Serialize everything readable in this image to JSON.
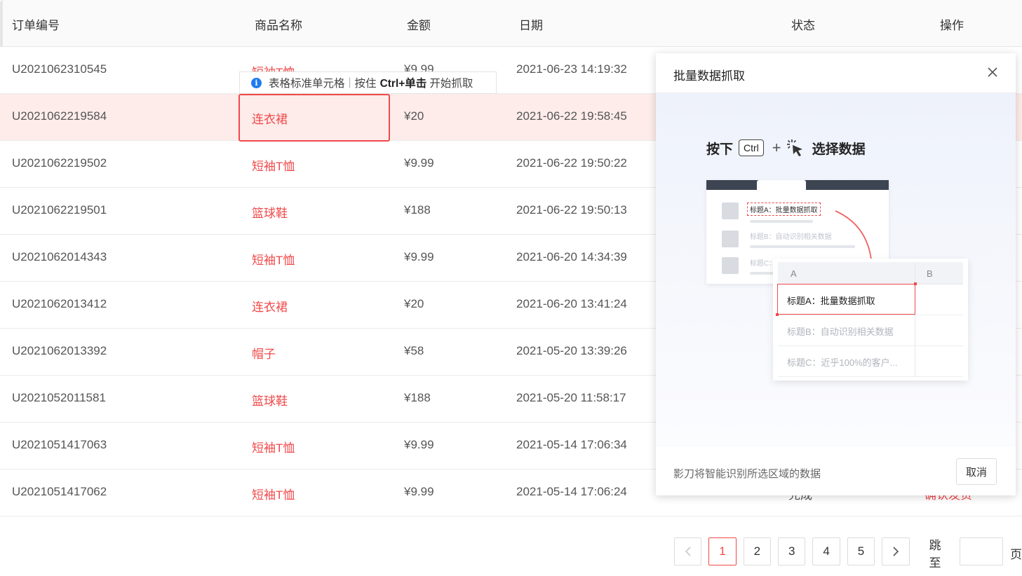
{
  "table": {
    "headers": {
      "order_id": "订单编号",
      "product": "商品名称",
      "amount": "金额",
      "date": "日期",
      "status": "状态",
      "action": "操作"
    },
    "rows": [
      {
        "order_id": "U2021062310545",
        "product": "短袖T恤",
        "amount": "¥9.99",
        "date": "2021-06-23 14:19:32",
        "status": "",
        "action": ""
      },
      {
        "order_id": "U2021062219584",
        "product": "连衣裙",
        "amount": "¥20",
        "date": "2021-06-22 19:58:45",
        "status": "",
        "action": ""
      },
      {
        "order_id": "U2021062219502",
        "product": "短袖T恤",
        "amount": "¥9.99",
        "date": "2021-06-22 19:50:22",
        "status": "",
        "action": ""
      },
      {
        "order_id": "U2021062219501",
        "product": "篮球鞋",
        "amount": "¥188",
        "date": "2021-06-22 19:50:13",
        "status": "",
        "action": ""
      },
      {
        "order_id": "U2021062014343",
        "product": "短袖T恤",
        "amount": "¥9.99",
        "date": "2021-06-20 14:34:39",
        "status": "",
        "action": ""
      },
      {
        "order_id": "U2021062013412",
        "product": "连衣裙",
        "amount": "¥20",
        "date": "2021-06-20 13:41:24",
        "status": "",
        "action": ""
      },
      {
        "order_id": "U2021062013392",
        "product": "帽子",
        "amount": "¥58",
        "date": "2021-05-20 13:39:26",
        "status": "",
        "action": ""
      },
      {
        "order_id": "U2021052011581",
        "product": "篮球鞋",
        "amount": "¥188",
        "date": "2021-05-20 11:58:17",
        "status": "",
        "action": ""
      },
      {
        "order_id": "U2021051417063",
        "product": "短袖T恤",
        "amount": "¥9.99",
        "date": "2021-05-14 17:06:34",
        "status": "",
        "action": ""
      },
      {
        "order_id": "U2021051417062",
        "product": "短袖T恤",
        "amount": "¥9.99",
        "date": "2021-05-14 17:06:24",
        "status": "完成",
        "action": "确认发货"
      }
    ]
  },
  "tooltip": {
    "icon": "info-icon",
    "type_text": "表格标准单元格",
    "hint_prefix": "按住",
    "hint_keys": "Ctrl+单击",
    "hint_suffix": "开始抓取"
  },
  "pagination": {
    "pages": [
      "1",
      "2",
      "3",
      "4",
      "5"
    ],
    "current": "1",
    "jump_label": "跳至",
    "jump_value": "",
    "page_unit": "页"
  },
  "modal": {
    "title": "批量数据抓取",
    "close_icon": "close-icon",
    "hint": "影刀将智能识别所选区域的数据",
    "cancel_label": "取消",
    "illustration": {
      "press": "按下",
      "key": "Ctrl",
      "plus": "+",
      "select": "选择数据",
      "browser_items": [
        "标题A：批量数据抓取",
        "标题B：自动识别相关数据",
        "标题C："
      ],
      "sheet_columns": [
        "A",
        "B"
      ],
      "sheet_rows": [
        "标题A：批量数据抓取",
        "标题B：自动识别相关数据",
        "标题C：近乎100%的客户..."
      ]
    }
  },
  "colors": {
    "accent": "#f0494a",
    "highlight_row": "#fdecea",
    "info_blue": "#1e7bf0"
  }
}
